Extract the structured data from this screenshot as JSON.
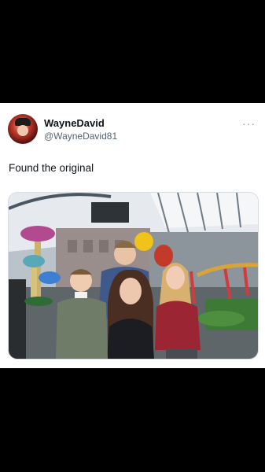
{
  "tweet": {
    "display_name": "WayneDavid",
    "handle": "@WayneDavid81",
    "more_icon": "ellipsis-icon",
    "text": "Found the original"
  },
  "colors": {
    "background": "#000000",
    "card": "#ffffff",
    "handle": "#536471",
    "name": "#0f1419"
  }
}
